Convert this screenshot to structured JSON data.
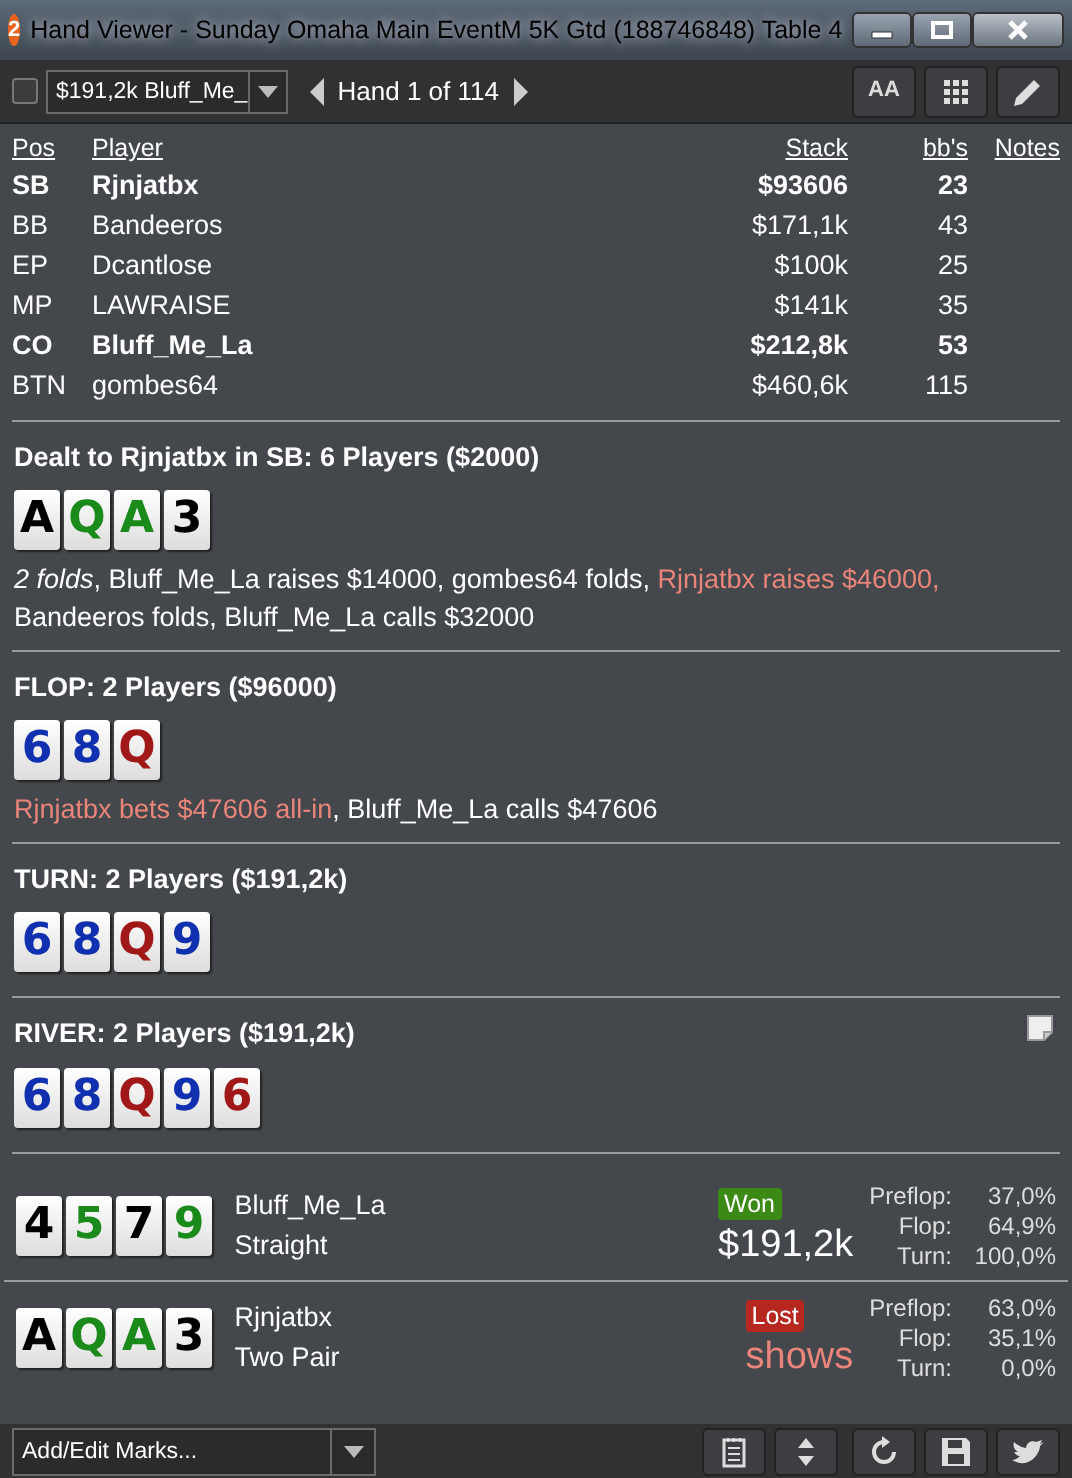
{
  "window": {
    "badge": "2",
    "title": "Hand Viewer - Sunday Omaha Main EventM 5K Gtd (188746848) Table 4"
  },
  "toolbar": {
    "checked": false,
    "hand_select": "$191,2k Bluff_Me_",
    "hand_counter": "Hand 1 of 114",
    "font_button": "AA"
  },
  "players": {
    "columns": [
      "Pos",
      "Player",
      "Stack",
      "bb's",
      "Notes"
    ],
    "rows": [
      {
        "pos": "SB",
        "player": "Rjnjatbx",
        "stack": "$93606",
        "bbs": "23",
        "highlighted": true
      },
      {
        "pos": "BB",
        "player": "Bandeeros",
        "stack": "$171,1k",
        "bbs": "43",
        "highlighted": false
      },
      {
        "pos": "EP",
        "player": "Dcantlose",
        "stack": "$100k",
        "bbs": "25",
        "highlighted": false
      },
      {
        "pos": "MP",
        "player": "LAWRAISE",
        "stack": "$141k",
        "bbs": "35",
        "highlighted": false
      },
      {
        "pos": "CO",
        "player": "Bluff_Me_La",
        "stack": "$212,8k",
        "bbs": "53",
        "highlighted": true
      },
      {
        "pos": "BTN",
        "player": "gombes64",
        "stack": "$460,6k",
        "bbs": "115",
        "highlighted": false
      }
    ]
  },
  "streets": [
    {
      "heading": "Dealt to Rjnjatbx in SB: 6 Players ($2000)",
      "note": false,
      "cards": [
        {
          "rank": "A",
          "color": "#000000"
        },
        {
          "rank": "Q",
          "color": "#1a8a1a"
        },
        {
          "rank": "A",
          "color": "#1a8a1a"
        },
        {
          "rank": "3",
          "color": "#000000"
        }
      ],
      "actions": [
        {
          "kind": "summary",
          "text": "2 folds"
        },
        {
          "kind": "plain",
          "text": ", Bluff_Me_La raises $14000, gombes64 folds, "
        },
        {
          "kind": "hero",
          "text": "Rjnjatbx raises $46000,"
        },
        {
          "kind": "plain",
          "text": " Bandeeros folds, Bluff_Me_La calls $32000"
        }
      ]
    },
    {
      "heading": "FLOP: 2 Players ($96000)",
      "note": false,
      "cards": [
        {
          "rank": "6",
          "color": "#1030b0"
        },
        {
          "rank": "8",
          "color": "#1030b0"
        },
        {
          "rank": "Q",
          "color": "#a01818"
        }
      ],
      "actions": [
        {
          "kind": "hero",
          "text": "Rjnjatbx bets $47606 all-in"
        },
        {
          "kind": "plain",
          "text": ", Bluff_Me_La calls $47606"
        }
      ]
    },
    {
      "heading": "TURN: 2 Players ($191,2k)",
      "note": false,
      "cards": [
        {
          "rank": "6",
          "color": "#1030b0"
        },
        {
          "rank": "8",
          "color": "#1030b0"
        },
        {
          "rank": "Q",
          "color": "#a01818"
        },
        {
          "rank": "9",
          "color": "#1030b0"
        }
      ]
    },
    {
      "heading": "RIVER: 2 Players ($191,2k)",
      "note": true,
      "cards": [
        {
          "rank": "6",
          "color": "#1030b0"
        },
        {
          "rank": "8",
          "color": "#1030b0"
        },
        {
          "rank": "Q",
          "color": "#a01818"
        },
        {
          "rank": "9",
          "color": "#1030b0"
        },
        {
          "rank": "6",
          "color": "#a01818"
        }
      ]
    }
  ],
  "showdown": [
    {
      "player": "Bluff_Me_La",
      "hand": "Straight",
      "result": {
        "kind": "won",
        "label": "Won"
      },
      "amount": "$191,2k",
      "cards": [
        {
          "rank": "4",
          "color": "#000000"
        },
        {
          "rank": "5",
          "color": "#1a8a1a"
        },
        {
          "rank": "7",
          "color": "#000000"
        },
        {
          "rank": "9",
          "color": "#1a8a1a"
        }
      ],
      "equity": [
        {
          "label": "Preflop:",
          "value": "37,0%"
        },
        {
          "label": "Flop:",
          "value": "64,9%"
        },
        {
          "label": "Turn:",
          "value": "100,0%"
        }
      ]
    },
    {
      "player": "Rjnjatbx",
      "hand": "Two Pair",
      "result": {
        "kind": "lost",
        "label": "Lost"
      },
      "amount": "shows",
      "cards": [
        {
          "rank": "A",
          "color": "#000000"
        },
        {
          "rank": "Q",
          "color": "#1a8a1a"
        },
        {
          "rank": "A",
          "color": "#1a8a1a"
        },
        {
          "rank": "3",
          "color": "#000000"
        }
      ],
      "equity": [
        {
          "label": "Preflop:",
          "value": "63,0%"
        },
        {
          "label": "Flop:",
          "value": "35,1%"
        },
        {
          "label": "Turn:",
          "value": "0,0%"
        }
      ]
    }
  ],
  "footer": {
    "marks_select": "Add/Edit Marks..."
  }
}
